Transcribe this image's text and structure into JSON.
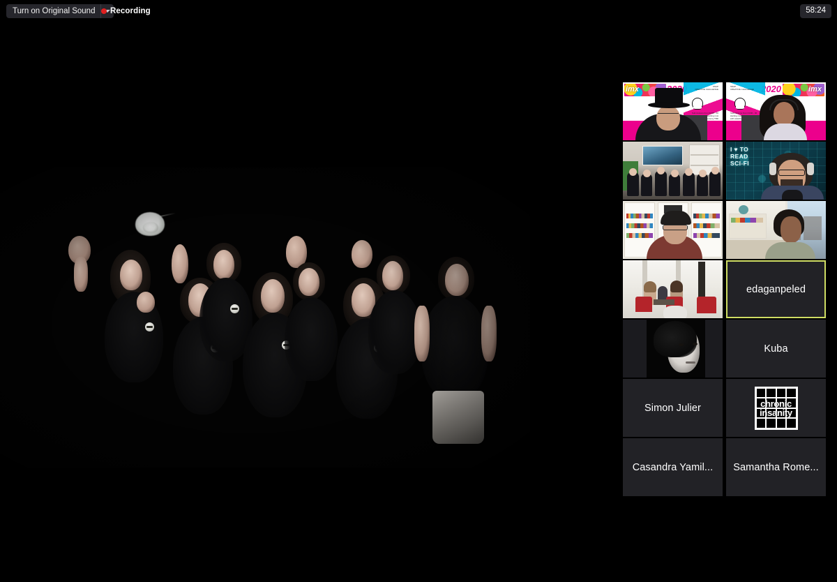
{
  "meeting": {
    "background_color": "#000000",
    "timer": "58:24"
  },
  "toolbar": {
    "original_sound_label": "Turn on Original Sound",
    "original_sound_caret_icon": "chevron-down-icon",
    "recording_label": "Recording",
    "recording_dot_color": "#e02020"
  },
  "stage": {
    "description": "Group of performers in black shirts on a black background, arms raised, with a white lamp-like object floating at upper left"
  },
  "grid": {
    "active_border_color": "#cfdd63",
    "tiles": [
      {
        "id": "tile-1",
        "type": "video",
        "name": "",
        "scene": "man-in-top-hat-imx2020-snapchat-background",
        "overlay_text": [
          "imx",
          "2020",
          "SNAP",
          "CREATIVE CHALLENGE"
        ],
        "active": false
      },
      {
        "id": "tile-2",
        "type": "video",
        "name": "",
        "scene": "woman-with-headphones-imx2020-snapchat-background",
        "overlay_text": [
          "OSOS",
          "2020",
          "imx",
          "SNAP",
          "CREATIVE CHALLENGE"
        ],
        "active": false
      },
      {
        "id": "tile-3",
        "type": "video",
        "name": "",
        "scene": "group-of-people-in-room-with-bookshelves-and-artwork",
        "overlay_text": [],
        "active": false
      },
      {
        "id": "tile-4",
        "type": "video",
        "name": "",
        "scene": "bearded-man-with-headphones-sci-fi-circuit-background",
        "overlay_text": [
          "I",
          "TO",
          "READ",
          "SCI-FI"
        ],
        "active": false
      },
      {
        "id": "tile-5",
        "type": "video",
        "name": "",
        "scene": "person-with-cap-and-glasses-in-front-of-white-bookshelves",
        "overlay_text": [],
        "active": false
      },
      {
        "id": "tile-6",
        "type": "video",
        "name": "",
        "scene": "man-in-office-by-window-with-bookshelf",
        "overlay_text": [],
        "active": false
      },
      {
        "id": "tile-7",
        "type": "video",
        "name": "",
        "scene": "bright-cafe-lounge-with-people-seated-in-red-chairs",
        "overlay_text": [],
        "active": false
      },
      {
        "id": "tile-8",
        "type": "name",
        "name": "edaganpeled",
        "scene": "",
        "overlay_text": [],
        "active": true
      },
      {
        "id": "tile-9",
        "type": "avatar",
        "name": "",
        "scene": "black-and-white-portrait-photo-of-woman",
        "overlay_text": [],
        "active": false
      },
      {
        "id": "tile-10",
        "type": "name",
        "name": "Kuba",
        "scene": "",
        "overlay_text": [],
        "active": false
      },
      {
        "id": "tile-11",
        "type": "name",
        "name": "Simon Julier",
        "scene": "",
        "overlay_text": [],
        "active": false
      },
      {
        "id": "tile-12",
        "type": "avatar",
        "name": "",
        "scene": "chronic-insanity-logo",
        "overlay_text": [
          "chronic",
          "insanity"
        ],
        "active": false
      },
      {
        "id": "tile-13",
        "type": "name",
        "name": "Casandra Yamil...",
        "scene": "",
        "overlay_text": [],
        "active": false
      },
      {
        "id": "tile-14",
        "type": "name",
        "name": "Samantha Rome...",
        "scene": "",
        "overlay_text": [],
        "active": false
      }
    ]
  }
}
